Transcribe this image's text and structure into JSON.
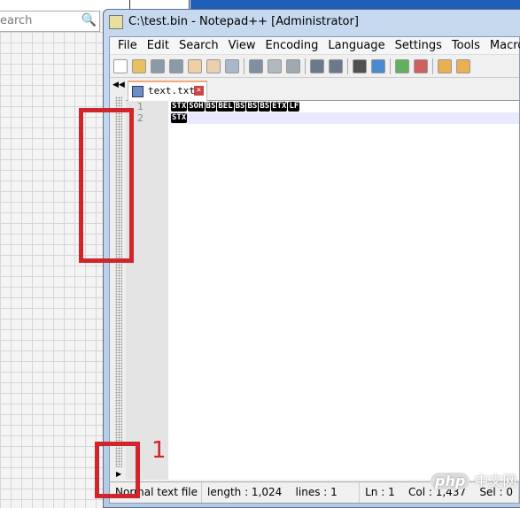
{
  "background": {
    "search_placeholder": "earch",
    "search_icon": "magnifier-icon"
  },
  "window": {
    "title": "C:\\test.bin - Notepad++ [Administrator]"
  },
  "menu": [
    "File",
    "Edit",
    "Search",
    "View",
    "Encoding",
    "Language",
    "Settings",
    "Tools",
    "Macro"
  ],
  "toolbar_icons": [
    "new-file-icon",
    "open-file-icon",
    "save-icon",
    "save-all-icon",
    "close-icon",
    "close-all-icon",
    "print-icon",
    "cut-icon",
    "copy-icon",
    "paste-icon",
    "undo-icon",
    "redo-icon",
    "find-icon",
    "replace-icon",
    "zoom-in-icon",
    "zoom-out-icon",
    "sync-vertical-icon",
    "sync-horizontal-icon"
  ],
  "tab": {
    "label": "text.txt"
  },
  "editor": {
    "line_numbers": [
      "1",
      "2"
    ],
    "lines": [
      [
        "STX",
        "SOH",
        "BS",
        "BEL",
        "BS",
        "BS",
        "BS",
        "ETX",
        "LF"
      ],
      [
        "STX"
      ]
    ]
  },
  "status": {
    "type": "Normal text file",
    "length": "length : 1,024",
    "lines": "lines : 1",
    "ln": "Ln : 1",
    "col": "Col : 1,437",
    "sel": "Sel : 0"
  },
  "annotation": {
    "label": "1",
    "color": "#d1242b"
  },
  "watermark": {
    "brand": "php",
    "text": "中文网"
  }
}
